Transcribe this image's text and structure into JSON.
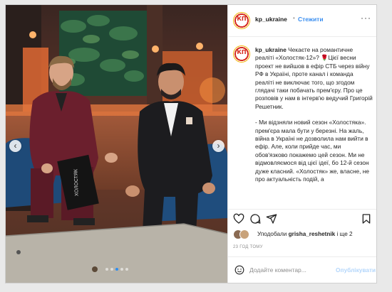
{
  "post": {
    "username": "kp_ukraine",
    "avatar_text": "КП",
    "bullet": "•",
    "follow_label": "Стежити",
    "more_label": "···",
    "caption_user": "kp_ukraine",
    "caption_p1": "Чекаєте на романтичне реаліті «Холостяк-12»? 🌹Цієї весни проект не вийшов в ефір СТБ через війну РФ в Україні, проте канал і команда реаліті не виключає того, що згодом глядачі таки побачать прем'єру. Про це розповів у нам в інтерв'ю ведучий Григорій Решетник.",
    "caption_p2": "- Ми відзняли новий сезон «Холостяка». прем'єра мала бути у березні. На жаль, війна в Україні не дозволила нам вийти в ефір. Але, коли прийде час, ми обов'язково покажемо цей сезон. Ми не відмовляємося від цієї ідеї, бо 12-й сезон дуже класний. «Холостяк» же, власне, не про актуальність подій, а",
    "likes_prefix": "Уподобали",
    "likes_user": "grisha_reshetnik",
    "likes_suffix": "і ще 2",
    "timestamp": "23 ГОД ТОМУ",
    "comment_placeholder": "Додайте коментар...",
    "publish_label": "Опублікувати",
    "prev_label": "‹",
    "next_label": "›",
    "book_text": "ХОЛОСТЯК",
    "carousel": {
      "count": 5,
      "active": 3
    },
    "colors": {
      "accent": "#3b8ff0",
      "publish_disabled": "#b3d6fb"
    }
  }
}
